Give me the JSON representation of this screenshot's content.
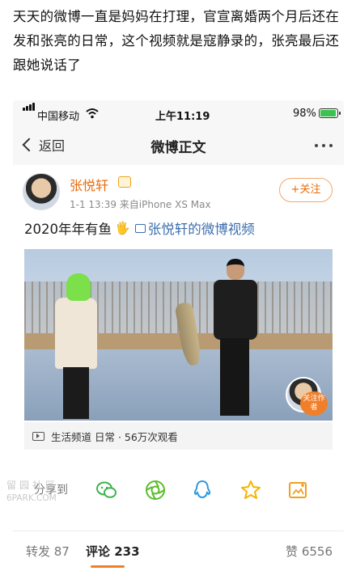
{
  "caption": "天天的微博一直是妈妈在打理，官宣离婚两个月后还在发和张亮的日常，这个视频就是寇静录的，张亮最后还跟她说话了",
  "status_bar": {
    "carrier": "中国移动",
    "time": "上午11:19",
    "battery": "98%",
    "battery_level": 0.98
  },
  "nav": {
    "back_label": "返回",
    "title": "微博正文"
  },
  "post": {
    "username": "张悦轩",
    "meta": "1-1 13:39  来自iPhone XS Max",
    "follow_label": "+关注",
    "text": "2020年年有鱼",
    "hand_emoji": "🖐",
    "video_link": "张悦轩的微博视频",
    "video_follow_label": "关注作者",
    "video_info": "生活频道 日常 · 56万次观看"
  },
  "share": {
    "label": "分享到",
    "targets": [
      "wechat-icon",
      "moments-icon",
      "qq-icon",
      "qzone-icon",
      "save-image-icon"
    ],
    "colors": {
      "wechat": "#3cb44b",
      "moments": "#5bbd2b",
      "qq": "#2d9ae0",
      "qzone": "#f5b400",
      "save": "#f0a020"
    }
  },
  "counts": {
    "repost": "转发 87",
    "comment": "评论 233",
    "like": "赞 6556"
  },
  "watermark": {
    "line1": "留园社区",
    "line2": "6PARK.COM"
  }
}
